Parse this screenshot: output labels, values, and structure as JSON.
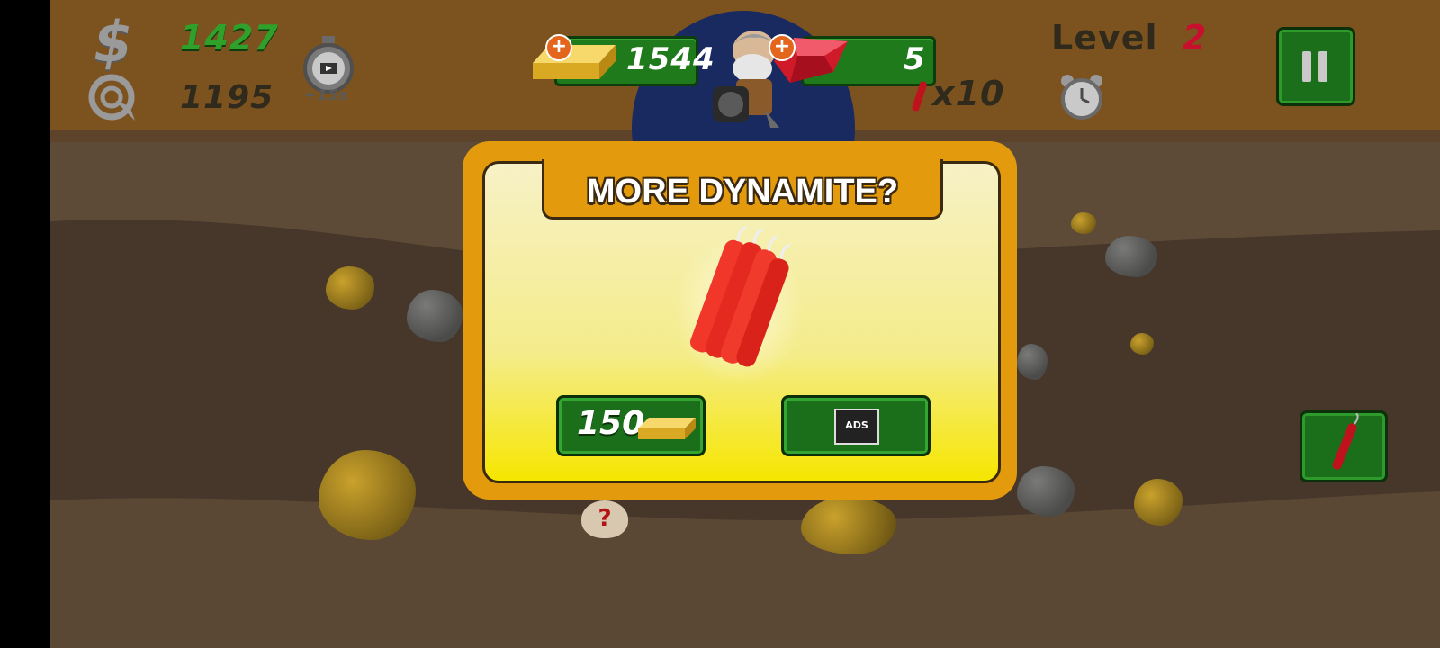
{
  "hud": {
    "money_symbol": "$",
    "money": "1427",
    "target": "1195",
    "timer_bonus": "+15s",
    "gold_bars": "1544",
    "gems": "5",
    "dynamite_count": "x10",
    "level_label": "Level",
    "level_value": "2"
  },
  "popup": {
    "title": "MORE DYNAMITE?",
    "buy_price": "150",
    "ads_label": "ADS"
  },
  "field": {
    "mystery_bag_symbol": "?"
  },
  "colors": {
    "hud_bar": "#7c531f",
    "money_green": "#2fa02a",
    "level_red": "#c8102e",
    "modal_orange": "#e39a0c",
    "button_green": "#1b6e1a"
  },
  "icons": [
    "dollar-icon",
    "target-icon",
    "stopwatch-video-icon",
    "gold-bar-icon",
    "ruby-gem-icon",
    "gold-miner-icon",
    "dynamite-icon",
    "alarm-clock-icon",
    "pause-icon",
    "film-ad-icon"
  ]
}
